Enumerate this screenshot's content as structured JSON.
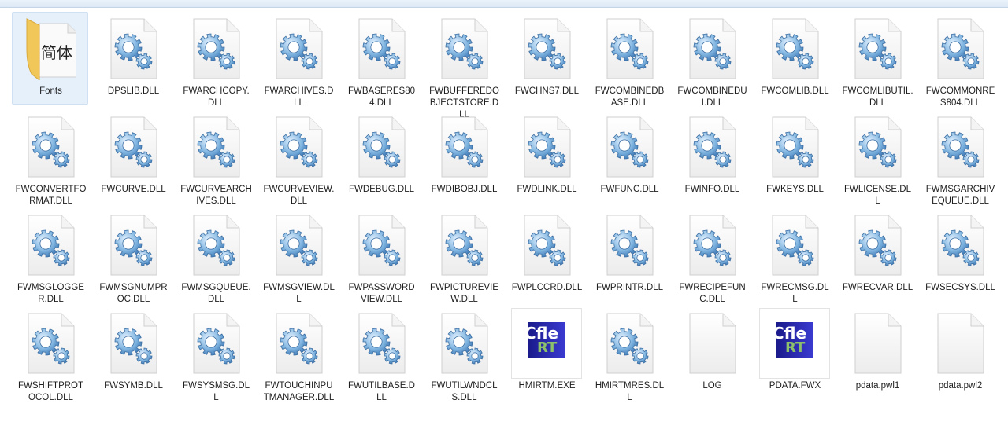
{
  "colors": {
    "selection": "#e5f0fb",
    "text": "#1e1e1e",
    "gear": "#6fa8d8"
  },
  "thumbnail_logo": {
    "line1": "Cfle",
    "line2": "RT"
  },
  "files": [
    {
      "name": "Fonts",
      "type": "font-folder",
      "folder_glyph": "简体",
      "selected": true
    },
    {
      "name": "DPSLIB.DLL",
      "type": "dll"
    },
    {
      "name": "FWARCHCOPY.DLL",
      "type": "dll"
    },
    {
      "name": "FWARCHIVES.DLL",
      "type": "dll"
    },
    {
      "name": "FWBASERES804.DLL",
      "type": "dll"
    },
    {
      "name": "FWBUFFEREDOBJECTSTORE.DLL",
      "type": "dll"
    },
    {
      "name": "FWCHNS7.DLL",
      "type": "dll"
    },
    {
      "name": "FWCOMBINEDBASE.DLL",
      "type": "dll"
    },
    {
      "name": "FWCOMBINEDUI.DLL",
      "type": "dll"
    },
    {
      "name": "FWCOMLIB.DLL",
      "type": "dll"
    },
    {
      "name": "FWCOMLIBUTIL.DLL",
      "type": "dll"
    },
    {
      "name": "FWCOMMONRES804.DLL",
      "type": "dll"
    },
    {
      "name": "FWCONVERTFORMAT.DLL",
      "type": "dll"
    },
    {
      "name": "FWCURVE.DLL",
      "type": "dll"
    },
    {
      "name": "FWCURVEARCHIVES.DLL",
      "type": "dll"
    },
    {
      "name": "FWCURVEVIEW.DLL",
      "type": "dll"
    },
    {
      "name": "FWDEBUG.DLL",
      "type": "dll"
    },
    {
      "name": "FWDIBOBJ.DLL",
      "type": "dll"
    },
    {
      "name": "FWDLINK.DLL",
      "type": "dll"
    },
    {
      "name": "FWFUNC.DLL",
      "type": "dll"
    },
    {
      "name": "FWINFO.DLL",
      "type": "dll"
    },
    {
      "name": "FWKEYS.DLL",
      "type": "dll"
    },
    {
      "name": "FWLICENSE.DLL",
      "type": "dll"
    },
    {
      "name": "FWMSGARCHIVEQUEUE.DLL",
      "type": "dll"
    },
    {
      "name": "FWMSGLOGGER.DLL",
      "type": "dll"
    },
    {
      "name": "FWMSGNUMPROC.DLL",
      "type": "dll"
    },
    {
      "name": "FWMSGQUEUE.DLL",
      "type": "dll"
    },
    {
      "name": "FWMSGVIEW.DLL",
      "type": "dll"
    },
    {
      "name": "FWPASSWORDVIEW.DLL",
      "type": "dll"
    },
    {
      "name": "FWPICTUREVIEW.DLL",
      "type": "dll"
    },
    {
      "name": "FWPLCCRD.DLL",
      "type": "dll"
    },
    {
      "name": "FWPRINTR.DLL",
      "type": "dll"
    },
    {
      "name": "FWRECIPEFUNC.DLL",
      "type": "dll"
    },
    {
      "name": "FWRECMSG.DLL",
      "type": "dll"
    },
    {
      "name": "FWRECVAR.DLL",
      "type": "dll"
    },
    {
      "name": "FWSECSYS.DLL",
      "type": "dll"
    },
    {
      "name": "FWSHIFTPROTOCOL.DLL",
      "type": "dll"
    },
    {
      "name": "FWSYMB.DLL",
      "type": "dll"
    },
    {
      "name": "FWSYSMSG.DLL",
      "type": "dll"
    },
    {
      "name": "FWTOUCHINPUTMANAGER.DLL",
      "type": "dll"
    },
    {
      "name": "FWUTILBASE.DLL",
      "type": "dll"
    },
    {
      "name": "FWUTILWNDCLS.DLL",
      "type": "dll"
    },
    {
      "name": "HMIRTM.EXE",
      "type": "wincc-thumb"
    },
    {
      "name": "HMIRTMRES.DLL",
      "type": "dll"
    },
    {
      "name": "LOG",
      "type": "blank"
    },
    {
      "name": "PDATA.FWX",
      "type": "wincc-thumb"
    },
    {
      "name": "pdata.pwl1",
      "type": "blank"
    },
    {
      "name": "pdata.pwl2",
      "type": "blank"
    }
  ]
}
